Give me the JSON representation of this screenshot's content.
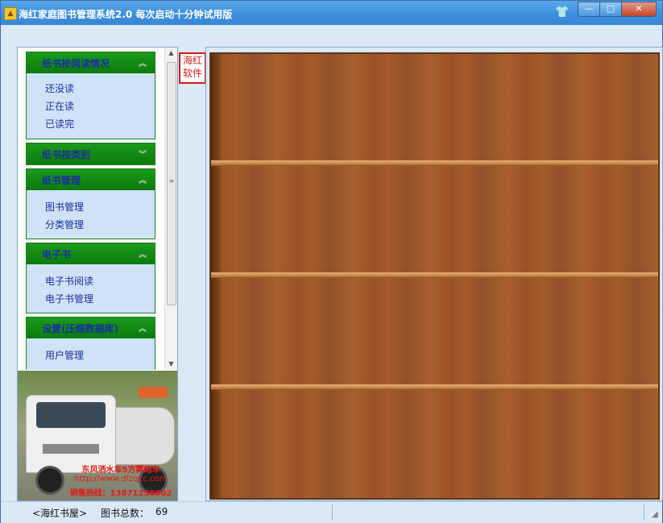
{
  "window": {
    "title": "海红家庭图书管理系统2.0 每次启动十分钟试用版",
    "controls": {
      "minimize": "—",
      "maximize": "□",
      "close": "✕"
    }
  },
  "nav": {
    "groups": [
      {
        "title": "纸书按阅读情况",
        "expanded": true,
        "items": [
          "还没读",
          "正在读",
          "已读完"
        ]
      },
      {
        "title": "纸书按类别",
        "expanded": false,
        "items": []
      },
      {
        "title": "纸书管理",
        "expanded": true,
        "items": [
          "图书管理",
          "分类管理"
        ]
      },
      {
        "title": "电子书",
        "expanded": true,
        "items": [
          "电子书阅读",
          "电子书管理"
        ]
      },
      {
        "title": "设置(压缩数据库)",
        "expanded": true,
        "items": [
          "用户管理"
        ]
      }
    ],
    "chevrons": {
      "expanded": "︽",
      "collapsed": "︾"
    }
  },
  "ad": {
    "line1": "东风洒水车5方雾炮车",
    "line2": "http://www.dfzqcc.com",
    "line3": "销售热线：13871258602"
  },
  "stamp": {
    "line1": "海红",
    "line2": "软件"
  },
  "status": {
    "left": "<海红书屋>",
    "count_label": "图书总数：",
    "count_value": "69"
  },
  "colors": {
    "titlebar": "#3d8fdd",
    "nav_header": "#0c7a0c",
    "nav_text": "#1a2f9e",
    "shelf_wood": "#9a5226"
  }
}
